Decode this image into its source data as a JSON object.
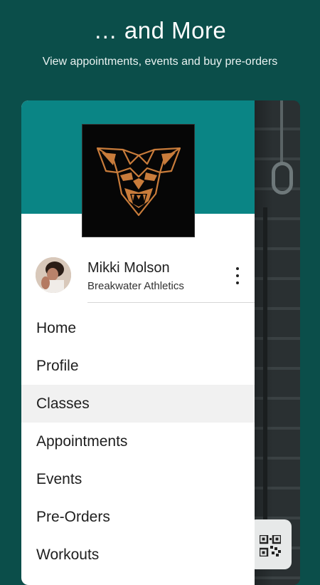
{
  "header": {
    "title": "… and More",
    "subtitle": "View appointments, events and buy pre-orders"
  },
  "user": {
    "name": "Mikki Molson",
    "gym": "Breakwater Athletics"
  },
  "menu": {
    "active_index": 2,
    "items": [
      {
        "label": "Home"
      },
      {
        "label": "Profile"
      },
      {
        "label": "Classes"
      },
      {
        "label": "Appointments"
      },
      {
        "label": "Events"
      },
      {
        "label": "Pre-Orders"
      },
      {
        "label": "Workouts"
      }
    ]
  },
  "colors": {
    "page_background": "#0b4e4a",
    "drawer_header": "#0a8585",
    "logo_orange": "#c97c3b",
    "active_item_bg": "#f1f1f1"
  },
  "icons": {
    "logo": "cougar-head-logo",
    "more": "more-vertical-icon",
    "qr": "qr-code-icon"
  }
}
